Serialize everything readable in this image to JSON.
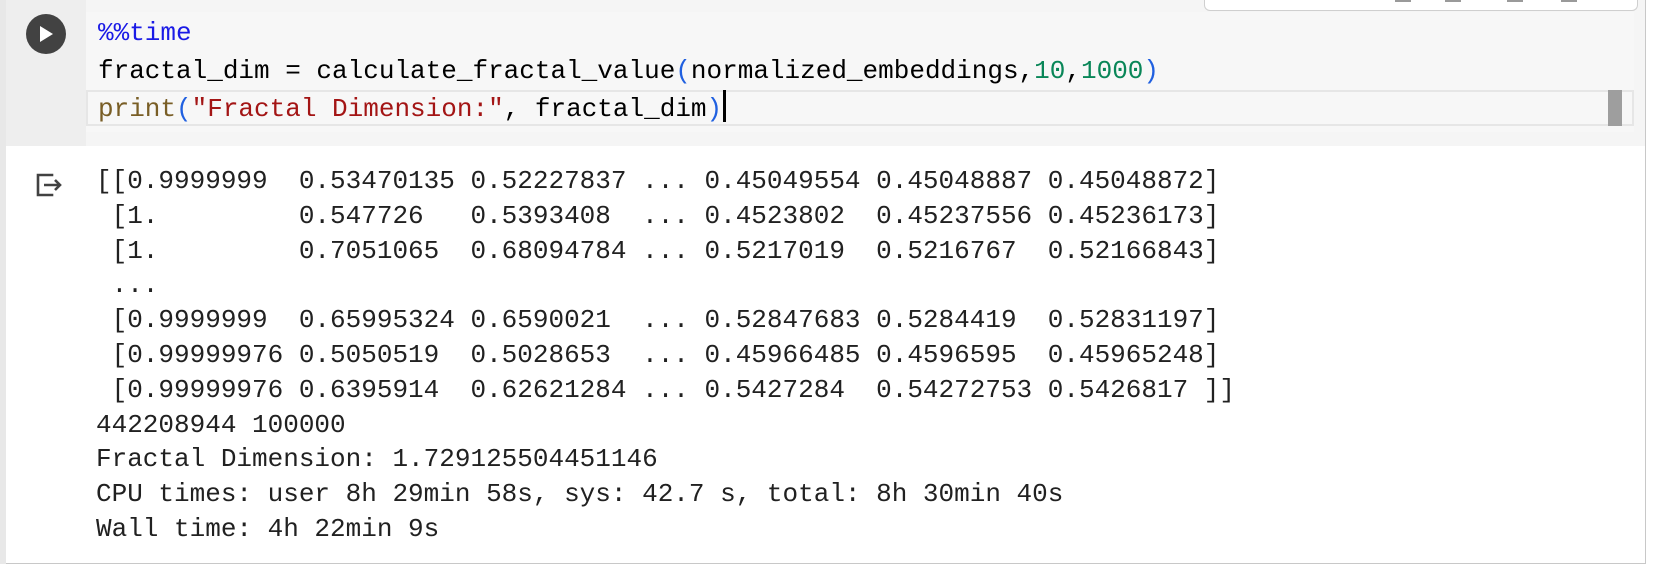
{
  "cell": {
    "run_button_label": "Run cell",
    "code_lines": [
      [
        {
          "text": "%%time",
          "cls": "kw-magic"
        }
      ],
      [
        {
          "text": "fractal_dim = calculate_fractal_value",
          "cls": ""
        },
        {
          "text": "(",
          "cls": "paren"
        },
        {
          "text": "normalized_embeddings,",
          "cls": ""
        },
        {
          "text": "10",
          "cls": "num"
        },
        {
          "text": ",",
          "cls": ""
        },
        {
          "text": "1000",
          "cls": "num"
        },
        {
          "text": ")",
          "cls": "paren"
        }
      ],
      [
        {
          "text": "print",
          "cls": "fn-builtin"
        },
        {
          "text": "(",
          "cls": "paren"
        },
        {
          "text": "\"Fractal Dimension:\"",
          "cls": "str"
        },
        {
          "text": ", fractal_dim",
          "cls": ""
        },
        {
          "text": ")",
          "cls": "paren"
        }
      ]
    ]
  },
  "output": {
    "lines": [
      "[[0.9999999  0.53470135 0.52227837 ... 0.45049554 0.45048887 0.45048872]",
      " [1.         0.547726   0.5393408  ... 0.4523802  0.45237556 0.45236173]",
      " [1.         0.7051065  0.68094784 ... 0.5217019  0.5216767  0.52166843]",
      " ...",
      " [0.9999999  0.65995324 0.6590021  ... 0.52847683 0.5284419  0.52831197]",
      " [0.99999976 0.5050519  0.5028653  ... 0.45966485 0.4596595  0.45965248]",
      " [0.99999976 0.6395914  0.62621284 ... 0.5427284  0.54272753 0.5426817 ]]",
      "442208944 100000",
      "Fractal Dimension: 1.729125504451146",
      "CPU times: user 8h 29min 58s, sys: 42.7 s, total: 8h 30min 40s",
      "Wall time: 4h 22min 9s"
    ]
  },
  "colors": {
    "magic": "#1a1ae6",
    "builtin": "#795e26",
    "paren": "#2060e0",
    "number": "#098658",
    "string": "#a31515"
  },
  "icons": {
    "run": "play-icon",
    "output": "output-redirect-icon"
  }
}
